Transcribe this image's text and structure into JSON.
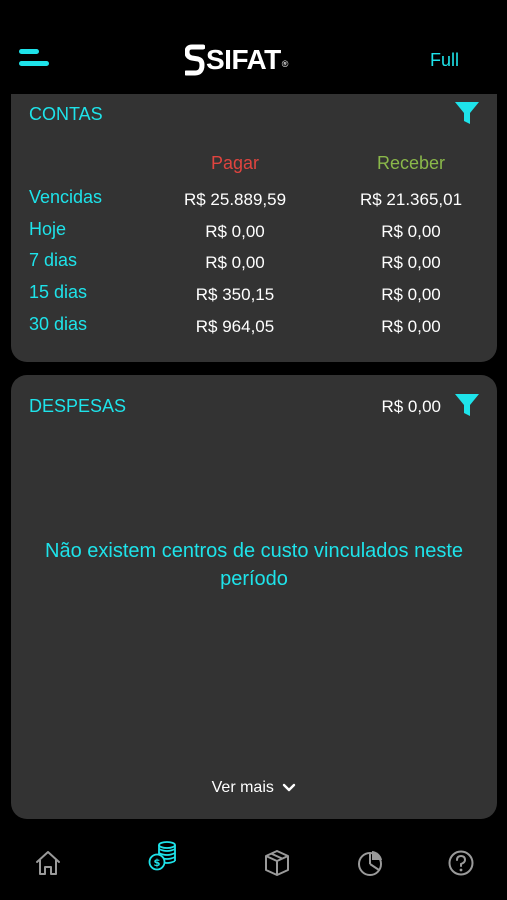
{
  "header": {
    "menu_icon": "menu-icon",
    "logo_text": "SIFAT",
    "logo_mark": "®",
    "mode_label": "Full"
  },
  "contas": {
    "title": "CONTAS",
    "filter_icon": "filter-icon",
    "columns": {
      "pagar": "Pagar",
      "receber": "Receber"
    },
    "rows": [
      {
        "label": "Vencidas",
        "pagar": "R$ 25.889,59",
        "receber": "R$ 21.365,01"
      },
      {
        "label": "Hoje",
        "pagar": "R$ 0,00",
        "receber": "R$ 0,00"
      },
      {
        "label": "7 dias",
        "pagar": "R$ 0,00",
        "receber": "R$ 0,00"
      },
      {
        "label": "15 dias",
        "pagar": "R$ 350,15",
        "receber": "R$ 0,00"
      },
      {
        "label": "30 dias",
        "pagar": "R$ 964,05",
        "receber": "R$ 0,00"
      }
    ]
  },
  "despesas": {
    "title": "DESPESAS",
    "total": "R$ 0,00",
    "filter_icon": "filter-icon",
    "empty_message": "Não existem centros de custo vinculados neste período",
    "see_more": "Ver mais"
  },
  "nav": {
    "items": [
      {
        "icon": "home-icon",
        "active": false
      },
      {
        "icon": "coins-icon",
        "active": true
      },
      {
        "icon": "box-icon",
        "active": false
      },
      {
        "icon": "pie-chart-icon",
        "active": false
      },
      {
        "icon": "help-icon",
        "active": false
      }
    ]
  },
  "colors": {
    "accent": "#1ee3ea",
    "pagar": "#e0443f",
    "receber": "#8ab84a",
    "card_bg": "#333333",
    "background": "#000000"
  }
}
